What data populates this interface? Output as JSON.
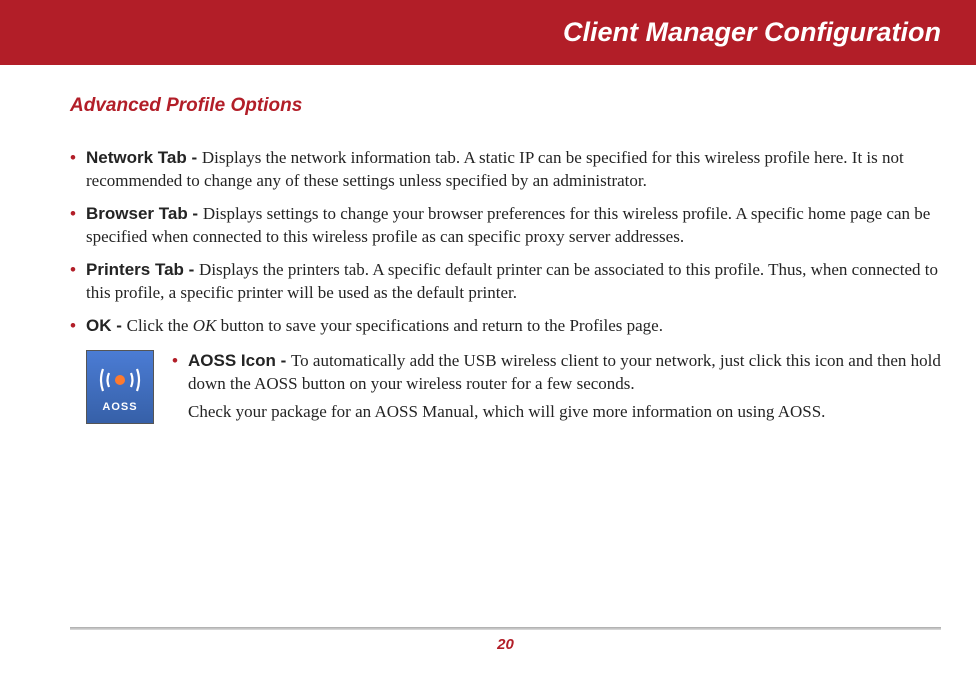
{
  "header": {
    "title": "Client Manager Configuration"
  },
  "section": {
    "title": "Advanced Profile Options"
  },
  "bullets": {
    "network": {
      "label": "Network Tab - ",
      "text": "Displays the network information tab.  A static IP can be specified for this wireless profile here.  It is not recommended to change any of these settings unless specified by an administrator."
    },
    "browser": {
      "label": "Browser Tab - ",
      "text": "Displays settings to change your browser preferences for this wireless profile.  A specific home page can be specified when connected to this wireless profile as can specific proxy server addresses."
    },
    "printers": {
      "label": "Printers Tab - ",
      "text": "Displays the printers tab.  A specific default printer can be associated to this profile.  Thus, when connected to this profile, a specific printer will be used as the default printer."
    },
    "ok": {
      "label": "OK - ",
      "text_before": "Click the ",
      "italic": "OK",
      "text_after": " button to save your specifications and return to the Profiles page."
    }
  },
  "aoss": {
    "icon_label": "AOSS",
    "label": "AOSS Icon - ",
    "text": "To automatically add the USB wireless client to your network, just click this icon and then hold down the AOSS button on your wireless router for a few seconds.",
    "followup": "Check your package for an AOSS Manual, which will give more information on using AOSS."
  },
  "footer": {
    "page_number": "20"
  }
}
